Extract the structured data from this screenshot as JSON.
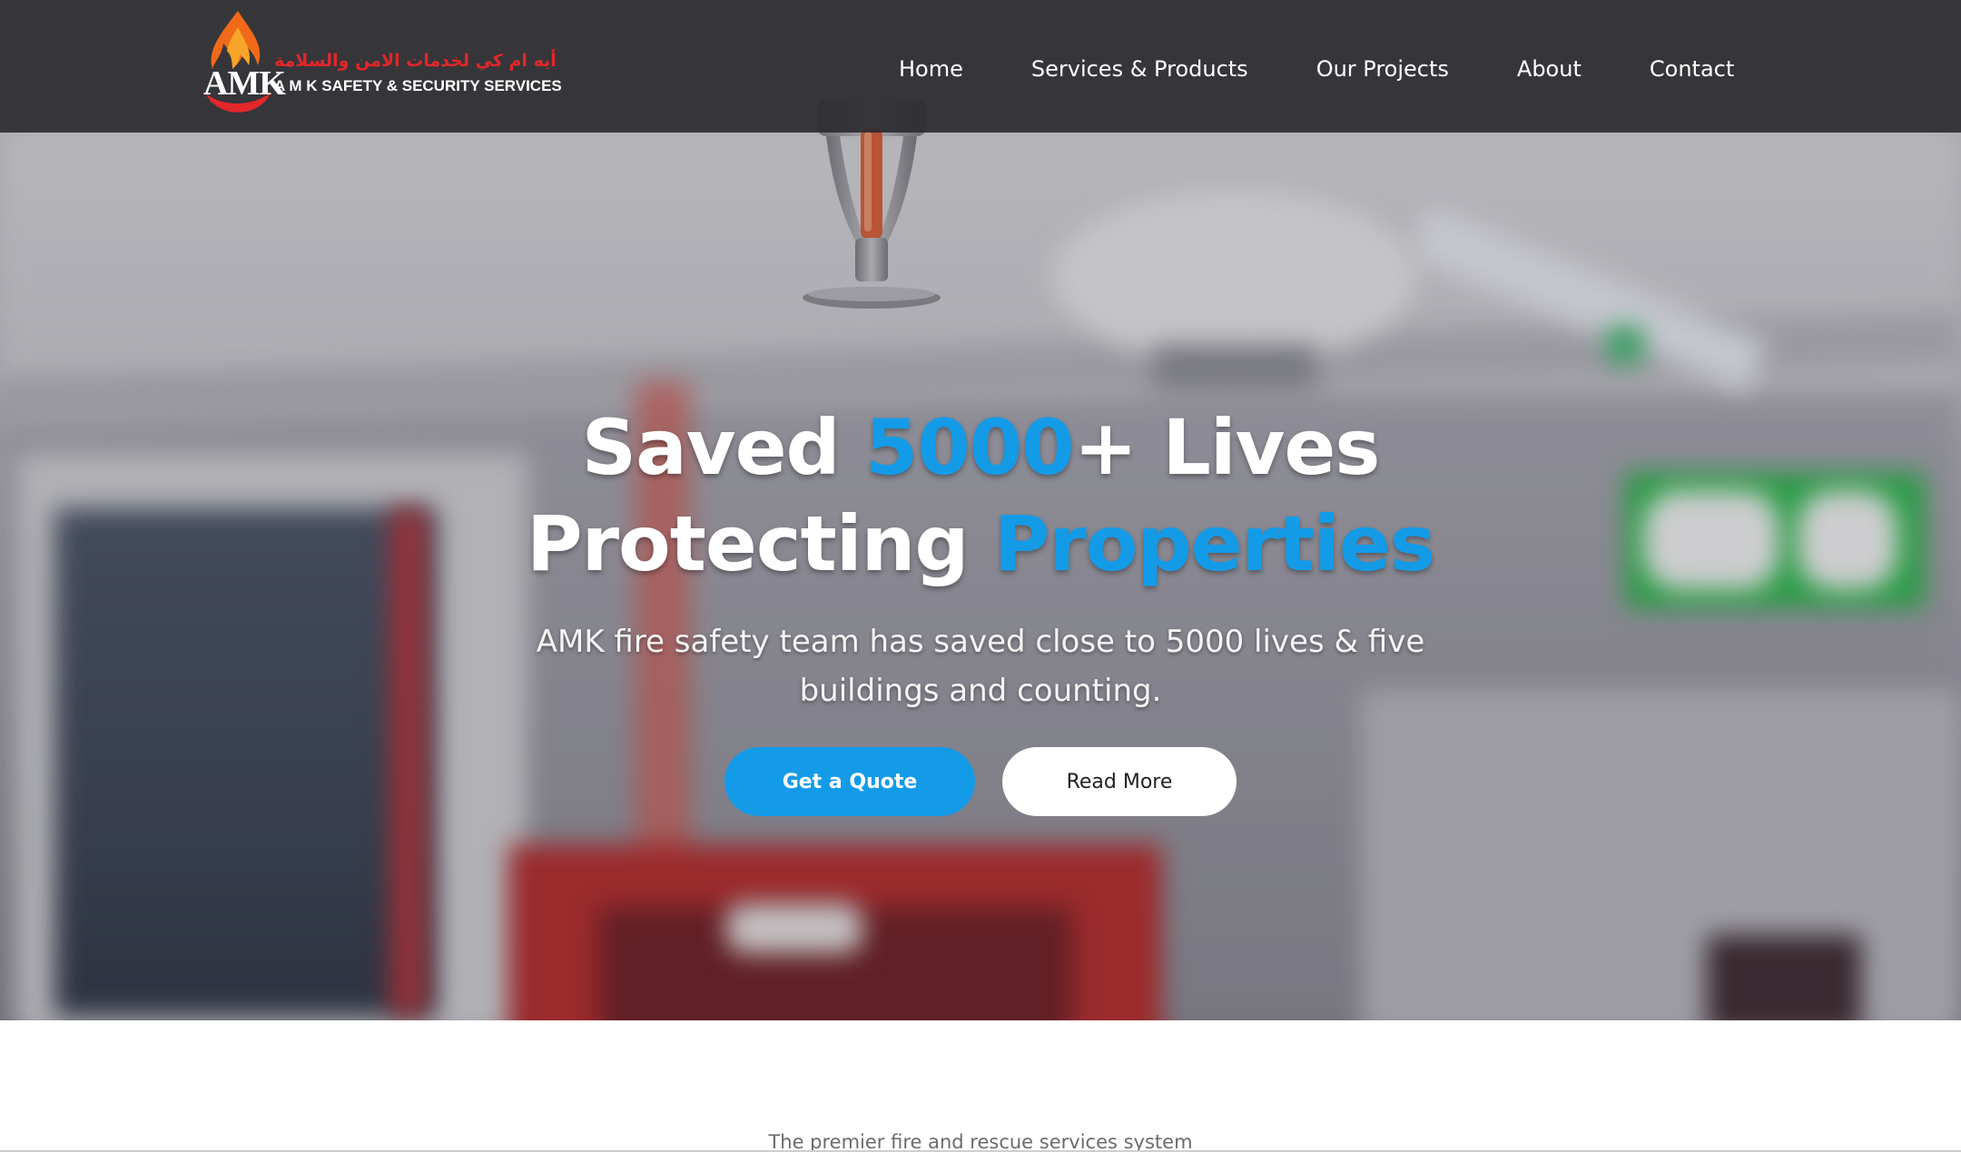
{
  "brand": {
    "logo_mark": "AMK",
    "logo_arabic": "أيه ام كي لخدمات الامن والسلامة",
    "logo_subtitle": "A M K SAFETY & SECURITY SERVICES",
    "accent_color": "#139be8",
    "logo_red": "#e3272a"
  },
  "nav": {
    "items": [
      {
        "label": "Home"
      },
      {
        "label": "Services & Products"
      },
      {
        "label": "Our Projects"
      },
      {
        "label": "About"
      },
      {
        "label": "Contact"
      }
    ]
  },
  "hero": {
    "line1_a": "Saved ",
    "line1_accent": "5000",
    "line1_b": "+ Lives",
    "line2_a": "Protecting ",
    "line2_accent": "Properties",
    "subtitle": "AMK fire safety team has saved close to 5000 lives & five buildings and counting.",
    "primary_button": "Get a Quote",
    "secondary_button": "Read More"
  },
  "below": {
    "tagline": "The premier fire and rescue services system"
  }
}
